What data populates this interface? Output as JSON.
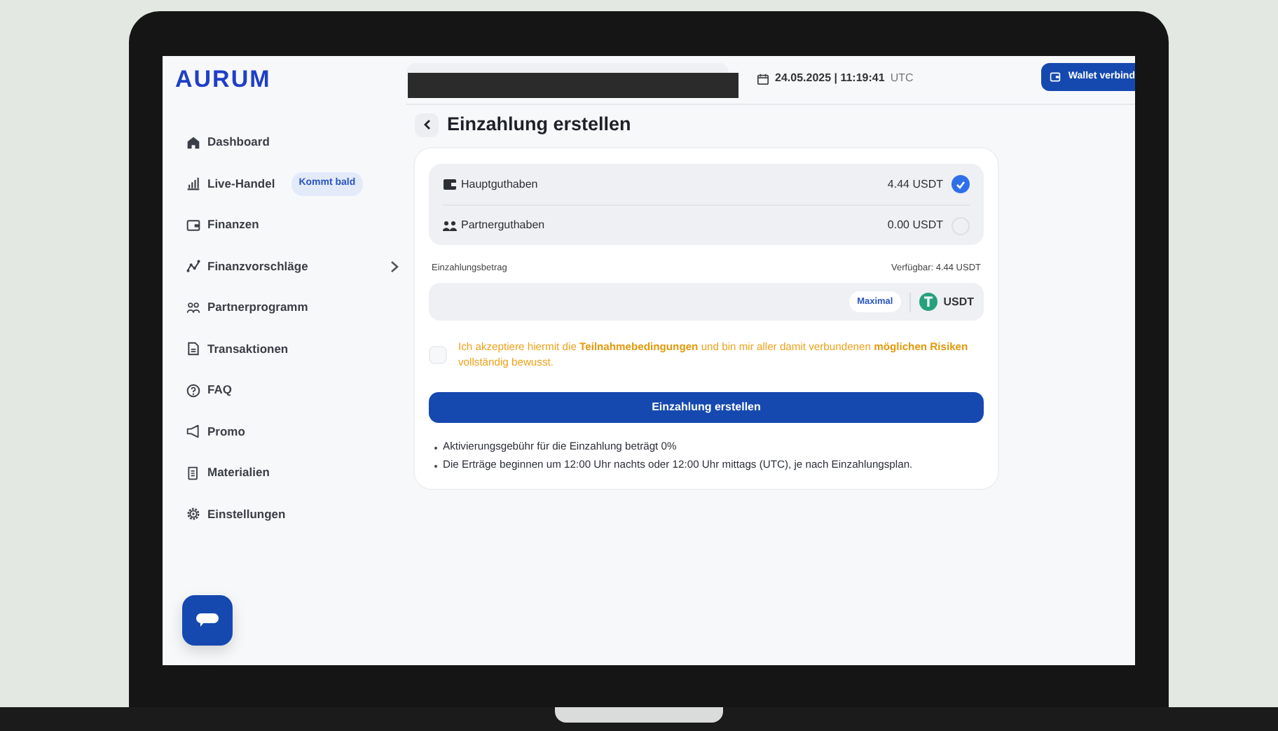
{
  "logo": "AURUM",
  "sidebar": {
    "items": [
      {
        "label": "Dashboard",
        "kind": "link"
      },
      {
        "label": "Live-Handel",
        "kind": "link",
        "badge": "Kommt bald"
      },
      {
        "label": "Finanzen",
        "kind": "link"
      },
      {
        "label": "Finanzvorschläge",
        "kind": "submenu"
      },
      {
        "label": "Partnerprogramm",
        "kind": "link"
      },
      {
        "label": "Transaktionen",
        "kind": "link"
      },
      {
        "label": "FAQ",
        "kind": "link"
      },
      {
        "label": "Promo",
        "kind": "link"
      },
      {
        "label": "Materialien",
        "kind": "link"
      },
      {
        "label": "Einstellungen",
        "kind": "link"
      }
    ]
  },
  "topbar": {
    "date": "24.05.2025 | 11:19:41",
    "timezone": "UTC",
    "wallet_button": "Wallet verbind"
  },
  "page": {
    "title": "Einzahlung erstellen",
    "balances": [
      {
        "label": "Hauptguthaben",
        "amount": "4.44 USDT",
        "selected": true
      },
      {
        "label": "Partnerguthaben",
        "amount": "0.00 USDT",
        "selected": false
      }
    ],
    "amount_field": {
      "label": "Einzahlungsbetrag",
      "available": "Verfügbar: 4.44 USDT",
      "max_button": "Maximal",
      "currency": "USDT"
    },
    "consent": {
      "checked": false,
      "text": "Ich akzeptiere hiermit die **Teilnahmebedingungen** und bin mir aller damit verbundenen **möglichen Risiken** vollständig bewusst."
    },
    "submit": "Einzahlung erstellen",
    "notes": [
      "Aktivierungsgebühr für die Einzahlung beträgt 0%",
      "Die Erträge beginnen um 12:00 Uhr nachts oder 12:00 Uhr mittags (UTC), je nach Einzahlungsplan."
    ]
  }
}
